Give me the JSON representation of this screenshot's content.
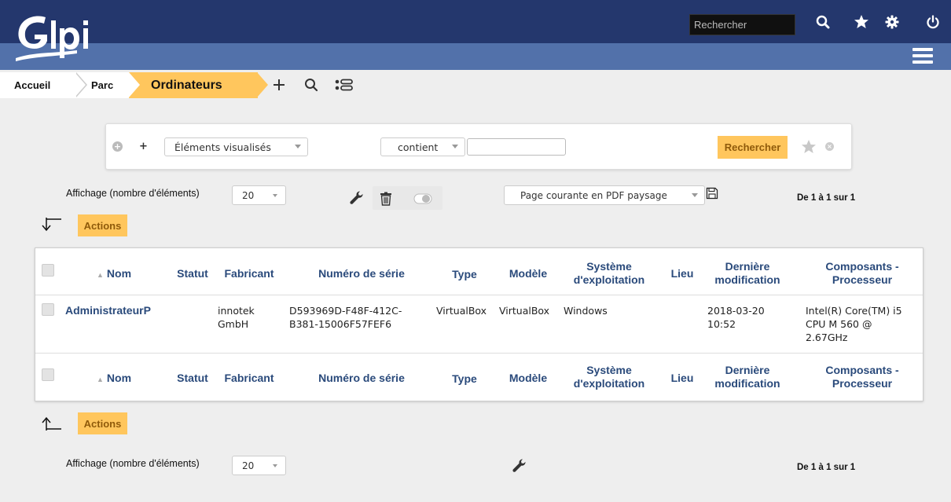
{
  "header": {
    "logo_text": "Glpi",
    "search_placeholder": "Rechercher",
    "icons": [
      "search-icon",
      "star-icon",
      "gear-icon",
      "power-icon",
      "menu-icon"
    ],
    "colors": {
      "top": "#24376d",
      "bottom": "#5271aa",
      "accent": "#ffc65d"
    }
  },
  "breadcrumb": {
    "home": "Accueil",
    "parc": "Parc",
    "current": "Ordinateurs",
    "icons": [
      "add-icon",
      "search-icon",
      "list-icon"
    ]
  },
  "search": {
    "field": "Éléments visualisés",
    "operator": "contient",
    "value": "",
    "button": "Rechercher"
  },
  "pager_top": {
    "label": "Affichage (nombre d'éléments)",
    "per_page": "20",
    "export_option": "Page courante en PDF paysage",
    "count": "De 1 à 1 sur 1"
  },
  "actions_label": "Actions",
  "table": {
    "columns": [
      "Nom",
      "Statut",
      "Fabricant",
      "Numéro de série",
      "Type",
      "Modèle",
      "Système d'exploitation",
      "Lieu",
      "Dernière modification",
      "Composants - Processeur"
    ],
    "header": {
      "nom": "Nom",
      "statut": "Statut",
      "fabricant": "Fabricant",
      "serie": "Numéro de série",
      "type": "Type",
      "modele": "Modèle",
      "os_1": "Système",
      "os_2": "d'exploitation",
      "lieu": "Lieu",
      "modif_1": "Dernière",
      "modif_2": "modification",
      "proc_1": "Composants -",
      "proc_2": "Processeur"
    },
    "rows": [
      {
        "nom": "AdministrateurP",
        "statut": "",
        "fabricant_1": "innotek",
        "fabricant_2": "GmbH",
        "serie_1": "D593969D-F48F-412C-",
        "serie_2": "B381-15006F57FEF6",
        "type": "VirtualBox",
        "modele": "VirtualBox",
        "os": "Windows",
        "lieu": "",
        "modif_1": "2018-03-20",
        "modif_2": "10:52",
        "proc_1": "Intel(R) Core(TM) i5",
        "proc_2": "CPU M 560 @",
        "proc_3": "2.67GHz"
      }
    ]
  },
  "pager_bottom": {
    "label": "Affichage (nombre d'éléments)",
    "per_page": "20",
    "count": "De 1 à 1 sur 1"
  }
}
